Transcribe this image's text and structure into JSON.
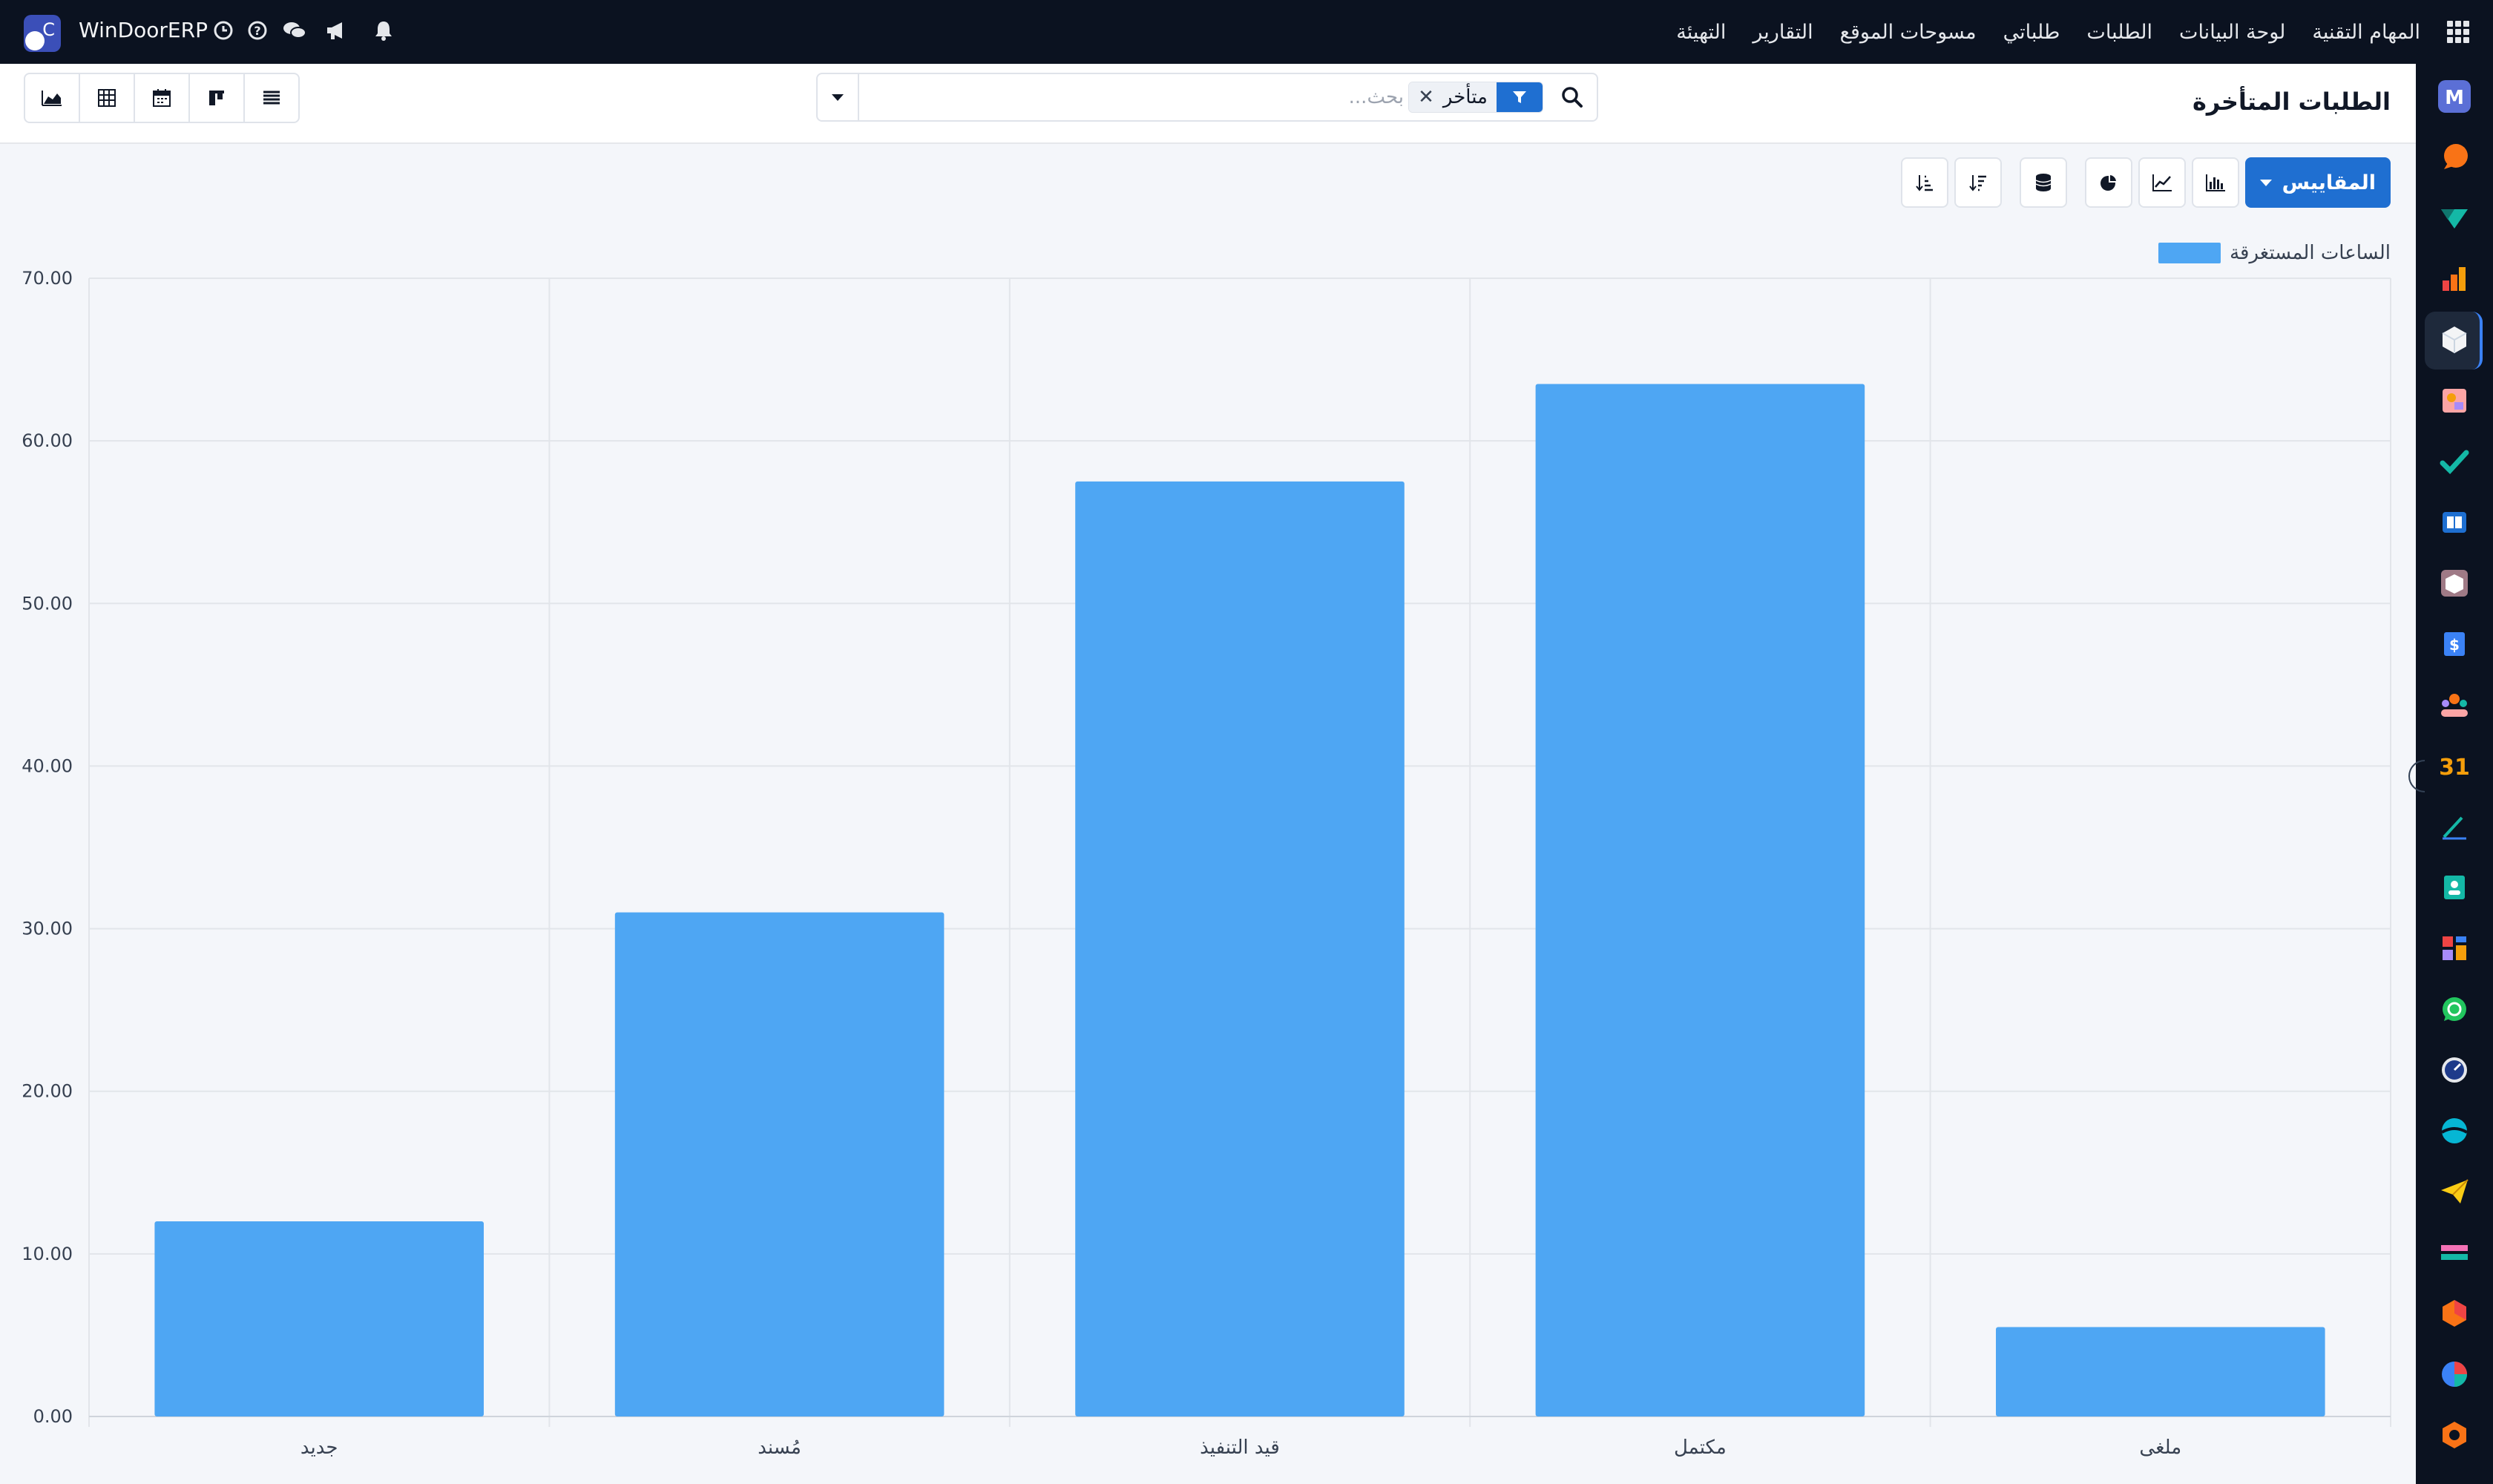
{
  "topbar": {
    "brand": "WinDoorERP",
    "menu": [
      "المهام التقنية",
      "لوحة البيانات",
      "الطلبات",
      "طلباتي",
      "مسوحات الموقع",
      "التقارير",
      "التهيئة"
    ]
  },
  "control_panel": {
    "title": "الطلبات المتأخرة",
    "search": {
      "placeholder": "بحث...",
      "facet_value": "متأخر"
    },
    "views": [
      "graph",
      "pivot",
      "calendar",
      "kanban",
      "list"
    ]
  },
  "chart_toolbar": {
    "measures_label": "المقاييس",
    "tools": [
      "bar-chart",
      "line-chart",
      "pie-chart",
      "stacked",
      "sort-descending",
      "sort-ascending"
    ]
  },
  "chart_data": {
    "type": "bar",
    "categories": [
      "جديد",
      "مُسند",
      "قيد التنفيذ",
      "مكتمل",
      "ملغى"
    ],
    "series": [
      {
        "name": "الساعات المستغرقة",
        "values": [
          12.0,
          31.0,
          57.5,
          63.5,
          5.5
        ],
        "color": "#4ea6f3"
      }
    ],
    "ylim": [
      0,
      70
    ],
    "yticks": [
      "0.00",
      "10.00",
      "20.00",
      "30.00",
      "40.00",
      "50.00",
      "60.00",
      "70.00"
    ],
    "grid": true,
    "legend_position": "top-right"
  },
  "colors": {
    "nav_bg": "#0b1220",
    "accent": "#1f6fd1",
    "bar": "#4ea6f3"
  }
}
